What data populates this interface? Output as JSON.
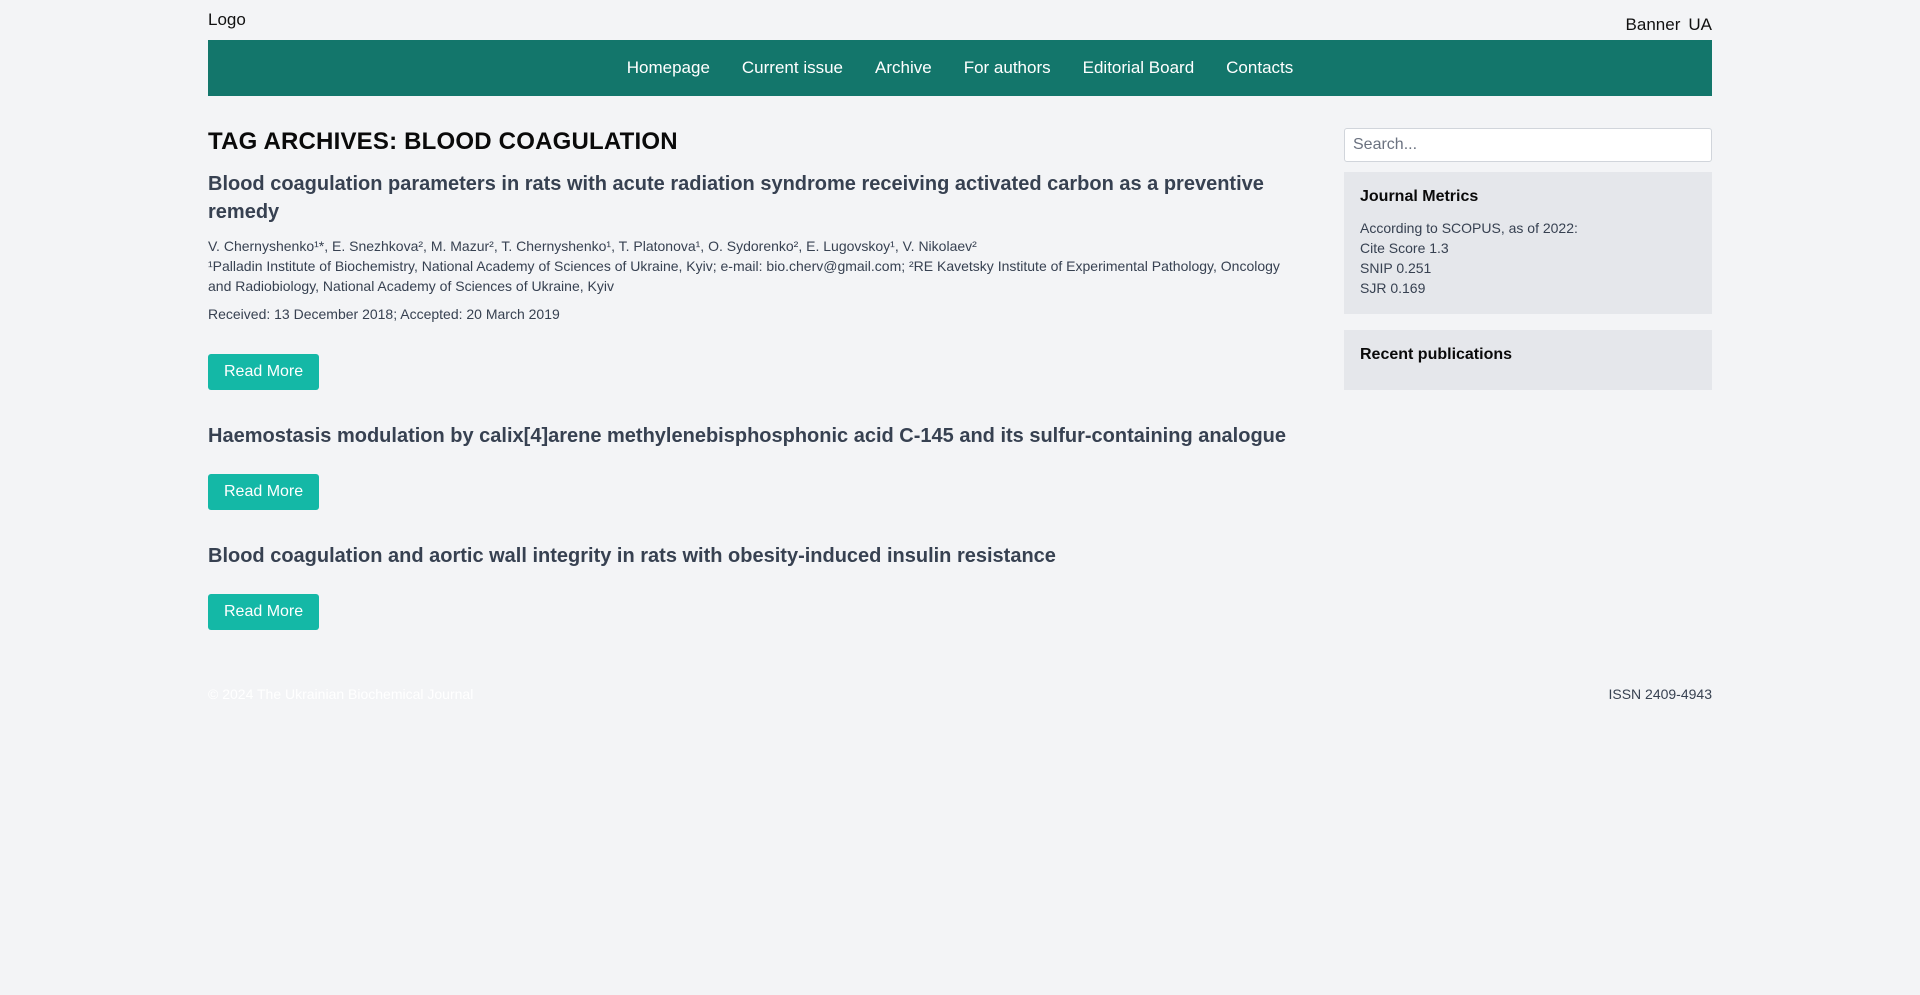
{
  "header": {
    "logo": "Logo",
    "banner": "Banner",
    "lang": "UA"
  },
  "nav": {
    "items": [
      "Homepage",
      "Current issue",
      "Archive",
      "For authors",
      "Editorial Board",
      "Contacts"
    ]
  },
  "main": {
    "title": "TAG ARCHIVES: BLOOD COAGULATION",
    "articles": [
      {
        "title": "Blood coagulation parameters in rats with acute radiation syndrome receiving activated carbon as a preventive remedy",
        "authors": "V. Chernyshenko¹*, E. Snezhkova², M. Mazur², T. Chernyshenko¹, T. Platonova¹, O. Sydorenko², E. Lugovskoy¹, V. Nikolaev²",
        "affiliation": "¹Palladin Institute of Biochemistry, National Academy of Sciences of Ukraine, Kyiv; e-mail: bio.cherv@gmail.com; ²RE Kavetsky Institute of Experimental Pathology, Oncology and Radiobiology, National Academy of Sciences of Ukraine, Kyiv",
        "dates": "Received: 13 December 2018; Accepted: 20 March 2019",
        "read_more": "Read More"
      },
      {
        "title": "Haemostasis modulation by calix[4]arene methylenebisphosphonic acid C-145 and its sulfur-containing analogue",
        "read_more": "Read More"
      },
      {
        "title": "Blood coagulation and aortic wall integrity in rats with obesity-induced insulin resistance",
        "read_more": "Read More"
      }
    ]
  },
  "sidebar": {
    "search_placeholder": "Search...",
    "metrics": {
      "title": "Journal Metrics",
      "lines": [
        "According to SCOPUS, as of 2022:",
        "Cite Score 1.3",
        "SNIP 0.251",
        "SJR 0.169"
      ]
    },
    "recent": {
      "title": "Recent publications"
    }
  },
  "footer": {
    "copyright": "© 2024 The Ukrainian Biochemical Journal",
    "issn": "ISSN 2409-4943"
  },
  "colors": {
    "nav_bg": "#13766b",
    "button_bg": "#14b8a6",
    "page_bg": "#f3f4f6",
    "widget_bg": "#e5e7eb"
  }
}
